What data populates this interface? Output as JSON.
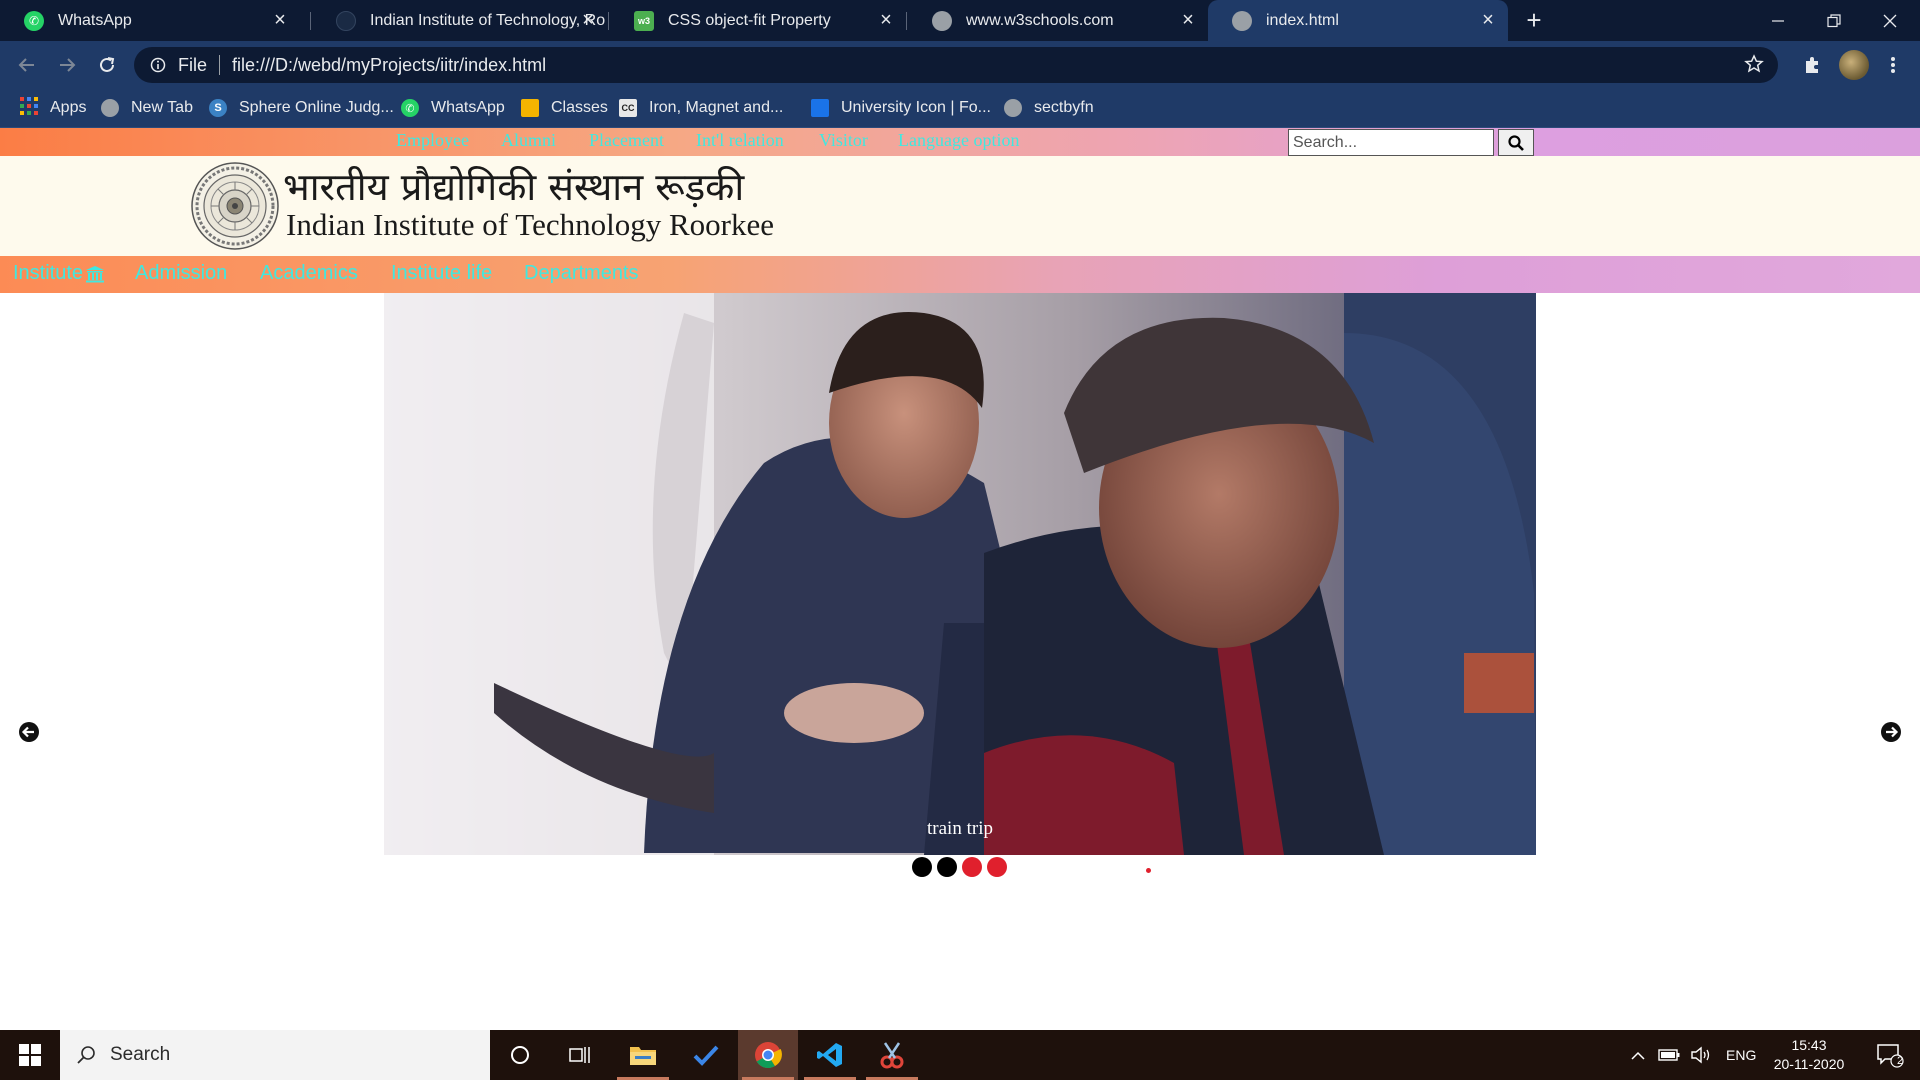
{
  "browser": {
    "tabs": [
      {
        "title": "WhatsApp",
        "icon": "whatsapp-icon",
        "active": false
      },
      {
        "title": "Indian Institute of Technology, Ro",
        "icon": "iitr-icon",
        "active": false
      },
      {
        "title": "CSS object-fit Property",
        "icon": "w3schools-icon",
        "active": false
      },
      {
        "title": "www.w3schools.com",
        "icon": "globe-icon",
        "active": false
      },
      {
        "title": "index.html",
        "icon": "globe-icon",
        "active": true
      }
    ],
    "address": {
      "scheme": "File",
      "url": "file:///D:/webd/myProjects/iitr/index.html"
    },
    "bookmarks": [
      {
        "label": "Apps",
        "icon": "apps-grid-icon"
      },
      {
        "label": "New Tab",
        "icon": "globe-icon"
      },
      {
        "label": "Sphere Online Judg...",
        "icon": "spoj-icon"
      },
      {
        "label": "WhatsApp",
        "icon": "whatsapp-icon"
      },
      {
        "label": "Classes",
        "icon": "classroom-icon"
      },
      {
        "label": "Iron, Magnet and...",
        "icon": "cc-icon"
      },
      {
        "label": "University Icon | Fo...",
        "icon": "flag-icon"
      },
      {
        "label": "sectbyfn",
        "icon": "globe-icon"
      }
    ]
  },
  "site": {
    "top_links": [
      "Employee",
      "Alumni",
      "Placement",
      "Int'l relation",
      "Visitor",
      "Language option"
    ],
    "search": {
      "placeholder": "Search..."
    },
    "title_hindi": "भारतीय प्रौद्योगिकी संस्थान रूड़की",
    "title_english": "Indian Institute of Technology Roorkee",
    "nav": [
      {
        "label": "Institute",
        "icon": "institution-icon"
      },
      {
        "label": "Admission"
      },
      {
        "label": "Academics"
      },
      {
        "label": "Institute life"
      },
      {
        "label": "Departments"
      }
    ],
    "slider": {
      "caption": "train trip",
      "dot_colors": [
        "#000000",
        "#000000",
        "#e0202d",
        "#e0202d"
      ]
    },
    "link_color": "#40e8e0"
  },
  "taskbar": {
    "search_placeholder": "Search",
    "apps": [
      "cortana-icon",
      "task-view-icon",
      "file-explorer-icon",
      "todo-icon",
      "chrome-icon",
      "vscode-icon",
      "snipping-tool-icon"
    ],
    "tray": {
      "language": "ENG",
      "time": "15:43",
      "date": "20-11-2020",
      "notifications": "2"
    }
  }
}
